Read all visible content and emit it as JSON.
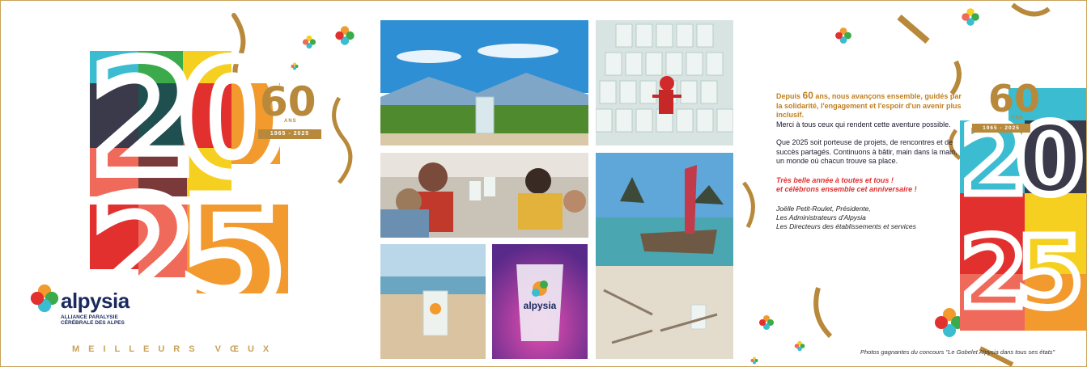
{
  "left_panel": {
    "year_top": "20",
    "year_bottom": "25",
    "badge_number": "60",
    "badge_unit": "ANS",
    "badge_years": "1965 - 2025",
    "brand_name": "alpysia",
    "brand_subtitle": "ALLIANCE PARALYSIE CÉRÉBRALE DES ALPES",
    "wishes": "MEILLEURS VŒUX"
  },
  "message": {
    "intro_lead": "Depuis ",
    "intro_number": "60",
    "intro_bold": " ans, nous avançons ensemble, guidés par la solidarité, l'engagement et l'espoir d'un avenir plus inclusif.",
    "intro_plain": "Merci à tous ceux qui rendent cette aventure possible.",
    "paragraph2": "Que 2025 soit porteuse de projets, de rencontres et de succès partagés. Continuons à bâtir, main dans la main, un monde où chacun trouve sa place.",
    "highlight_line1": "Très belle année à toutes et tous !",
    "highlight_line2": "et célébrons ensemble cet anniversaire !",
    "signature_line1": "Joëlle Petit-Roulet, Présidente,",
    "signature_line2": "Les Administrateurs d'Alpysia",
    "signature_line3": "Les Directeurs des établissements et services"
  },
  "caption": "Photos gagnantes du concours \"Le Gobelet Alpysia dans tous ses états\"",
  "photos": {
    "mountain": "mountain-landscape-cup",
    "stack": "stacked-cups-with-elf",
    "group": "friends-toasting-cups",
    "boat": "boat-beach-cup",
    "sand": "cup-in-sand",
    "purple": "cup-purple-light",
    "cup_label": "alpysia"
  },
  "right_panel": {
    "year_top": "20",
    "year_bottom": "25",
    "badge_number": "60",
    "badge_unit": "ANS",
    "badge_years": "1965 - 2025"
  },
  "colors": {
    "gold": "#c9a25a",
    "navy": "#1a2a5e",
    "red": "#e2302f",
    "orange": "#f29a2e",
    "teal": "#3bbcd0",
    "green": "#3aaa4a",
    "yellow": "#f5d020",
    "coral": "#ef6a5a"
  }
}
